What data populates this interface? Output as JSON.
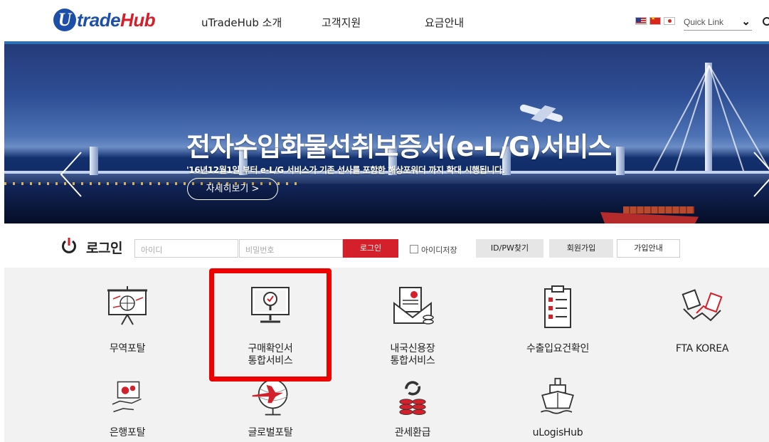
{
  "header": {
    "logo_badge": "U",
    "logo_text_a": "trade",
    "logo_text_b": "Hub",
    "nav": [
      "uTradeHub 소개",
      "고객지원",
      "요금안내"
    ],
    "quick_link": "Quick Link",
    "languages": [
      "english-flag",
      "chinese-flag",
      "japanese-flag"
    ]
  },
  "banner": {
    "headline": "전자수입화물선취보증서(e-L/G)서비스",
    "subline": "'16년12월1일 부터 e-L/G 서비스가 기존 선사를 포함한 해상포워더 까지 확대 시행됩니다.",
    "detail_button": "자세히보기 >",
    "pause_label": "II"
  },
  "login": {
    "title": "로그인",
    "id_placeholder": "아이디",
    "pw_placeholder": "비밀번호",
    "login_button": "로그인",
    "save_id": "아이디저장",
    "find_button": "ID/PW찾기",
    "join_button": "회원가입",
    "guide_button": "가입안내"
  },
  "services": [
    {
      "label": "무역포탈",
      "icon": "presentation-board-icon"
    },
    {
      "label": "구매확인서\n통합서비스",
      "icon": "monitor-magnifier-icon"
    },
    {
      "label": "내국신용장\n통합서비스",
      "icon": "certificate-envelope-icon"
    },
    {
      "label": "수출입요건확인",
      "icon": "checklist-clipboard-icon"
    },
    {
      "label": "FTA KOREA",
      "icon": "handshake-icon"
    },
    {
      "label": "은행포탈",
      "icon": "hand-money-icon"
    },
    {
      "label": "글로벌포탈",
      "icon": "globe-plane-icon"
    },
    {
      "label": "관세환급",
      "icon": "refund-coins-icon"
    },
    {
      "label": "uLogisHub",
      "icon": "cargo-ship-icon"
    }
  ],
  "colors": {
    "brand_blue": "#1d4fa8",
    "accent_red": "#d4202a",
    "highlight_red": "#ee0000"
  }
}
